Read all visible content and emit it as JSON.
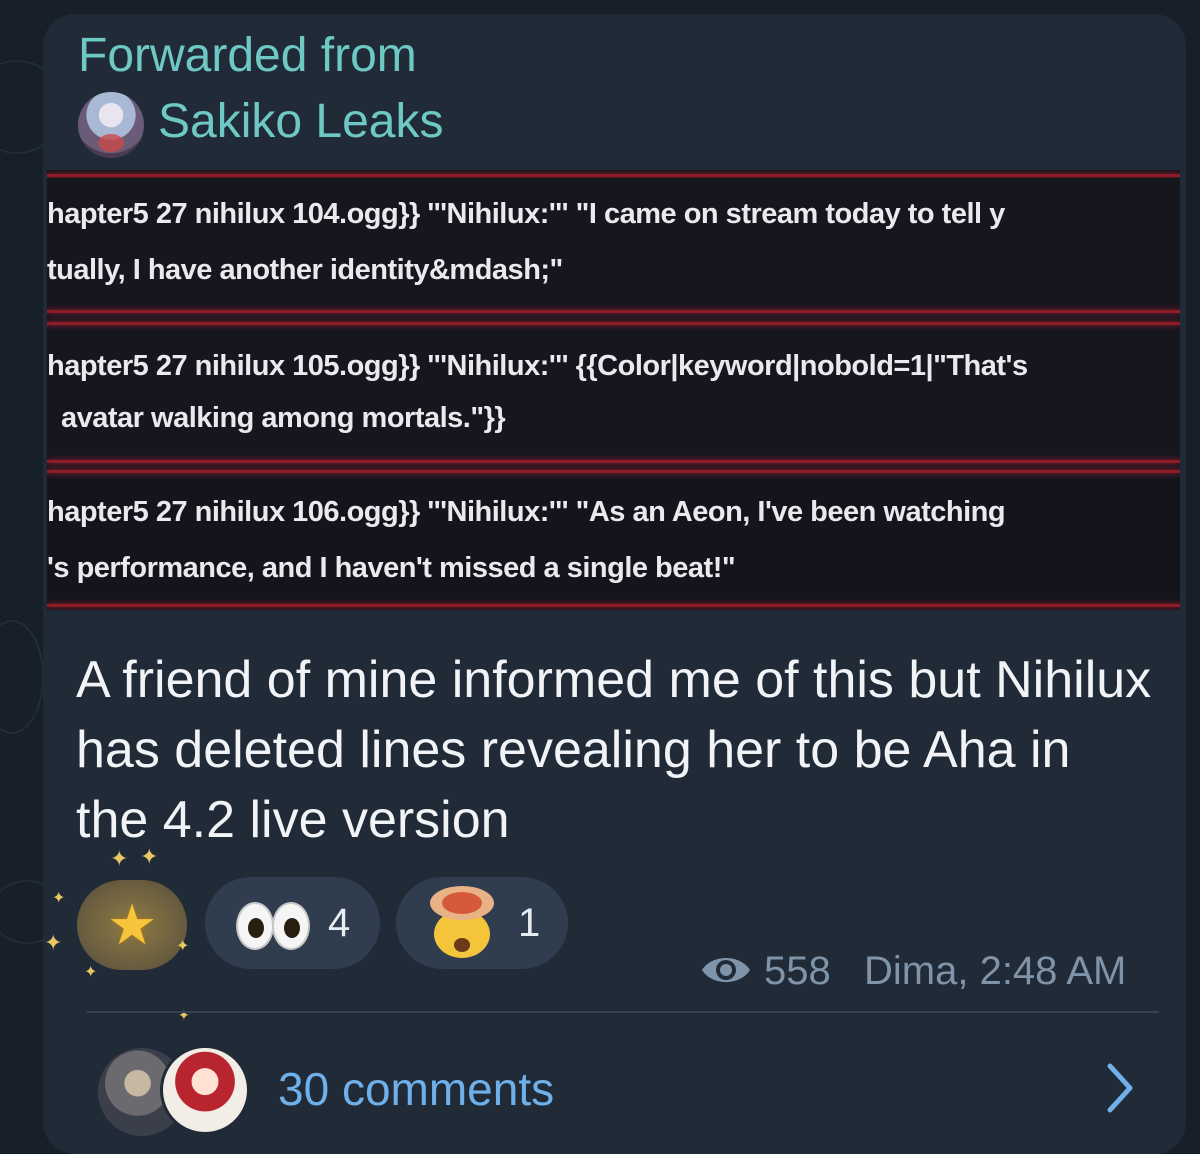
{
  "message": {
    "forwarded_label": "Forwarded from",
    "channel_name": "Sakiko Leaks",
    "screenshot_lines": [
      "hapter5 27 nihilux 104.ogg}} '''Nihilux:''' \"I came on stream today to tell y",
      "tually, I have another identity&mdash;\"",
      "hapter5 27 nihilux 105.ogg}} '''Nihilux:''' {{Color|keyword|nobold=1|\"That's",
      "avatar walking among mortals.\"}}",
      "hapter5 27 nihilux 106.ogg}} '''Nihilux:''' \"As an Aeon, I've been watching",
      "'s performance, and I haven't missed a single beat!\""
    ],
    "caption": "A friend of mine informed me of this but Nihilux has deleted lines revealing her to be Aha in the 4.2 live version",
    "reactions": [
      {
        "emoji": "star",
        "count": ""
      },
      {
        "emoji": "eyes",
        "count": "4"
      },
      {
        "emoji": "exploding-head",
        "count": "1"
      }
    ],
    "views": "558",
    "author_time": "Dima, 2:48 AM",
    "comments_label": "30 comments"
  },
  "colors": {
    "background": "#171f29",
    "bubble": "#202b37",
    "channel_accent": "#6ec8c3",
    "link": "#6fb0ea",
    "meta": "#7f93a9"
  }
}
